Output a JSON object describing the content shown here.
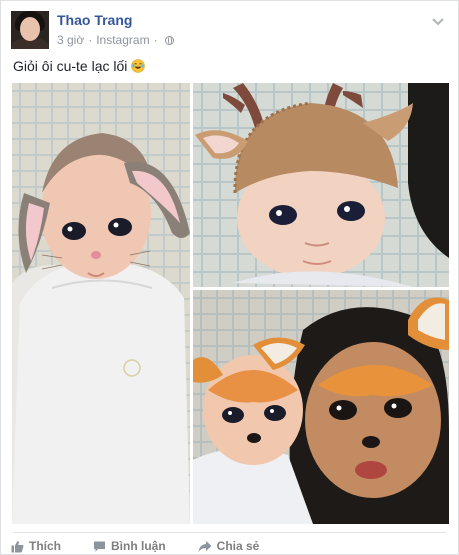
{
  "post": {
    "author": "Thao Trang",
    "time": "3 giờ",
    "separator": "·",
    "source": "Instagram",
    "privacy_icon": "globe-icon",
    "text": "Giỏi ôi cu-te lạc lối",
    "emoji_icon": "laughing-tears-emoji",
    "photos": [
      {
        "name": "baby-bunny-filter-photo"
      },
      {
        "name": "baby-reindeer-hat-photo"
      },
      {
        "name": "mother-baby-deer-filter-photo"
      }
    ]
  },
  "actions": {
    "like_label": "Thích",
    "comment_label": "Bình luận",
    "share_label": "Chia sẻ"
  },
  "colors": {
    "author_link": "#365899",
    "meta_text": "#90949c",
    "action_text": "#7f7f7f"
  }
}
